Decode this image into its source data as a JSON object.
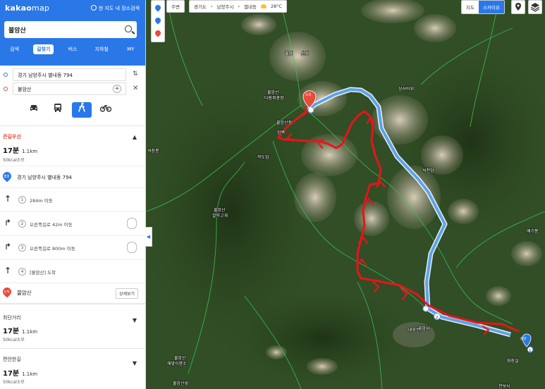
{
  "app": {
    "logo_main": "kakao",
    "logo_sub": "map",
    "map_search_toggle": "현 지도 내 장소검색"
  },
  "search": {
    "value": "불암산"
  },
  "tabs": [
    {
      "label": "검색"
    },
    {
      "label": "길찾기"
    },
    {
      "label": "버스"
    },
    {
      "label": "지하철"
    },
    {
      "label": "MY"
    }
  ],
  "route": {
    "origin": "경기 남양주시 별내동 794",
    "destination": "불암산"
  },
  "modes": {
    "car": "car-icon",
    "transit": "bus-icon",
    "walk": "walk-icon",
    "bike": "bike-icon"
  },
  "recommended": {
    "title": "큰길우선",
    "time": "17분",
    "distance": "1.1km",
    "kcal": "50kcal소모",
    "start_pin": "출발",
    "start_label": "경기 남양주시 별내동 794",
    "steps": [
      {
        "num": "1",
        "text": "284m 이동"
      },
      {
        "num": "2",
        "text": "오른쪽길로 42m 이동"
      },
      {
        "num": "3",
        "text": "오른쪽길로 800m 이동"
      },
      {
        "num": "4",
        "text": "[불암산] 도착"
      }
    ],
    "end_pin": "도착",
    "end_label": "불암산",
    "detail_button": "상세보기"
  },
  "alternatives": [
    {
      "title": "최단거리",
      "time": "17분",
      "distance": "1.1km",
      "kcal": "50kcal소모"
    },
    {
      "title": "편안한길",
      "time": "17분",
      "distance": "1.1km",
      "kcal": "50kcal소모"
    }
  ],
  "map": {
    "around_button": "주변",
    "breadcrumb": [
      "경기도",
      "남양주시",
      "별내동"
    ],
    "weather": "28°C",
    "view_toggle": [
      "지도",
      "스카이뷰"
    ],
    "markers": {
      "start": "출발",
      "end": "도착"
    },
    "labels": [
      "불암산 다람쥐광장",
      "불암산 암벽",
      "불암산 깔딱고개",
      "불암산성",
      "불암산 헬기장",
      "불암산 해맞이명소",
      "불암사",
      "대웅전",
      "학도암",
      "석천암",
      "석장봉",
      "애기봉",
      "상사바위",
      "깔딱고개",
      "불암산정"
    ],
    "colors": {
      "route_blue": "#5aa2ee",
      "route_red": "#e8141b",
      "accent": "#2a78e8",
      "dest": "#e64b3c"
    }
  }
}
